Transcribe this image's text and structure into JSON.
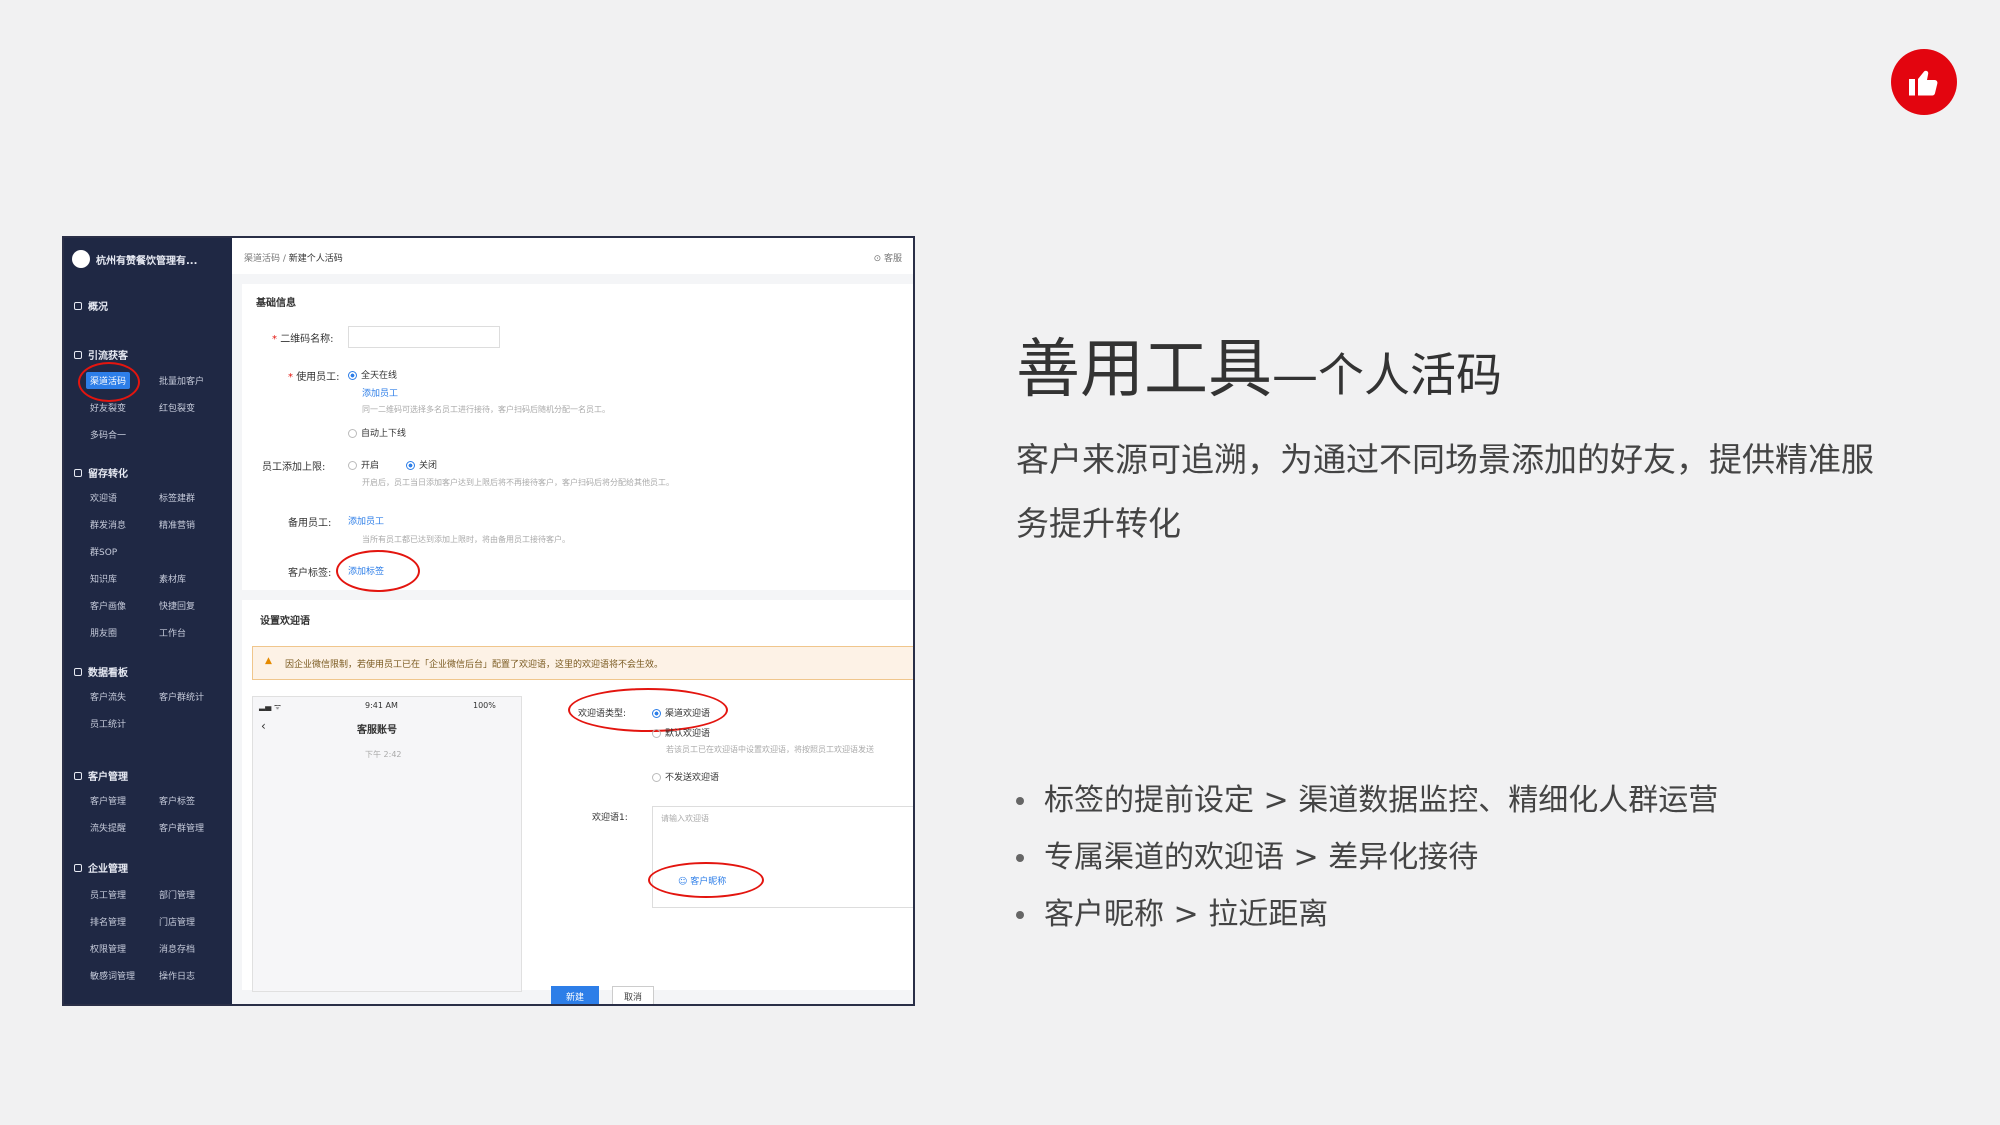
{
  "title": {
    "main": "善用工具",
    "sub": "—个人活码"
  },
  "description": "客户来源可追溯，为通过不同场景添加的好友，提供精准服务提升转化",
  "bullets": [
    "标签的提前设定 > 渠道数据监控、精细化人群运营",
    "专属渠道的欢迎语 > 差异化接待",
    "客户昵称 > 拉近距离"
  ],
  "colors": {
    "accent": "#e3050f",
    "sidebar": "#1f2844",
    "link": "#2d7ee8",
    "background": "#f1f1f2"
  },
  "like_icon": "thumbs-up-icon",
  "screenshot": {
    "brand": "杭州有赞餐饮管理有...",
    "breadcrumb": {
      "parent": "渠道活码",
      "current": "新建个人活码"
    },
    "help": "客服",
    "sidebar": [
      {
        "section": "概况",
        "items": []
      },
      {
        "section": "引流获客",
        "items": [
          "渠道活码",
          "批量加客户",
          "好友裂变",
          "红包裂变",
          "多码合一"
        ]
      },
      {
        "section": "留存转化",
        "items": [
          "欢迎语",
          "标签建群",
          "群发消息",
          "精准营销",
          "群SOP",
          "素材库",
          "知识库",
          "素材库",
          "客户画像",
          "快捷回复",
          "朋友圈",
          "工作台"
        ]
      },
      {
        "section": "数据看板",
        "items": [
          "客户流失",
          "客户群统计",
          "员工统计"
        ]
      },
      {
        "section": "客户管理",
        "items": [
          "客户管理",
          "客户标签",
          "流失提醒",
          "客户群管理"
        ]
      },
      {
        "section": "企业管理",
        "items": [
          "员工管理",
          "部门管理",
          "排名管理",
          "门店管理",
          "权限管理",
          "消息存档",
          "敏感词管理",
          "操作日志"
        ]
      }
    ],
    "form": {
      "basic_title": "基础信息",
      "qr_name_label": "二维码名称:",
      "staff_label": "使用员工:",
      "staff_option_all": "全天在线",
      "add_staff": "添加员工",
      "staff_hint": "同一二维码可选择多名员工进行接待，客户扫码后随机分配一名员工。",
      "staff_option_auto": "自动上下线",
      "limit_label": "员工添加上限:",
      "limit_on": "开启",
      "limit_off": "关闭",
      "limit_hint": "开启后，员工当日添加客户达到上限后将不再接待客户，客户扫码后将分配给其他员工。",
      "backup_label": "备用员工:",
      "backup_action": "添加员工",
      "backup_hint": "当所有员工都已达到添加上限时，将由备用员工接待客户。",
      "tag_label": "客户标签:",
      "tag_action": "添加标签",
      "welcome_title": "设置欢迎语",
      "warning": "因企业微信限制，若使用员工已在「企业微信后台」配置了欢迎语，这里的欢迎语将不会生效。",
      "phone_time": "9:41 AM",
      "phone_battery": "100%",
      "phone_title": "客服账号",
      "phone_sub": "下午 2:42",
      "welcome_type_label": "欢迎语类型:",
      "welcome_opt_channel": "渠道欢迎语",
      "welcome_opt_default": "默认欢迎语",
      "welcome_opt_default_hint": "若该员工已在欢迎语中设置欢迎语，将按照员工欢迎语发送",
      "welcome_opt_none": "不发送欢迎语",
      "welcome_msg_label": "欢迎语1:",
      "welcome_placeholder": "请输入欢迎语",
      "nickname_insert": "客户昵称",
      "btn_create": "新建",
      "btn_cancel": "取消"
    }
  }
}
